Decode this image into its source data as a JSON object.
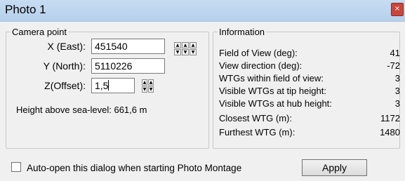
{
  "window": {
    "title": "Photo 1",
    "close_glyph": "×"
  },
  "camera": {
    "legend": "Camera point",
    "x_label": "X (East):",
    "x_value": "451540",
    "y_label": "Y (North):",
    "y_value": "5110226",
    "z_label": "Z(Offset):",
    "z_value": "1,5",
    "height_text": "Height above sea-level: 661,6 m",
    "nudge_buttons": [
      "▲",
      "▲",
      "▲",
      "▼",
      "▼",
      "▼"
    ],
    "spin_buttons": [
      "▲",
      "▲",
      "▼",
      "▼"
    ]
  },
  "information": {
    "legend": "Information",
    "rows": [
      {
        "label": "Field of View (deg):",
        "value": "41"
      },
      {
        "label": "View direction (deg):",
        "value": "-72"
      },
      {
        "label": "WTGs within field of view:",
        "value": "3"
      },
      {
        "label": "Visible WTGs at tip height:",
        "value": "3"
      },
      {
        "label": "Visible WTGs at hub height:",
        "value": "3"
      },
      {
        "label": "Closest WTG (m):",
        "value": "1172"
      },
      {
        "label": "Furthest WTG (m):",
        "value": "1480"
      }
    ]
  },
  "footer": {
    "auto_open_label": "Auto-open this dialog when starting Photo Montage",
    "auto_open_checked": false,
    "apply_label": "Apply"
  }
}
